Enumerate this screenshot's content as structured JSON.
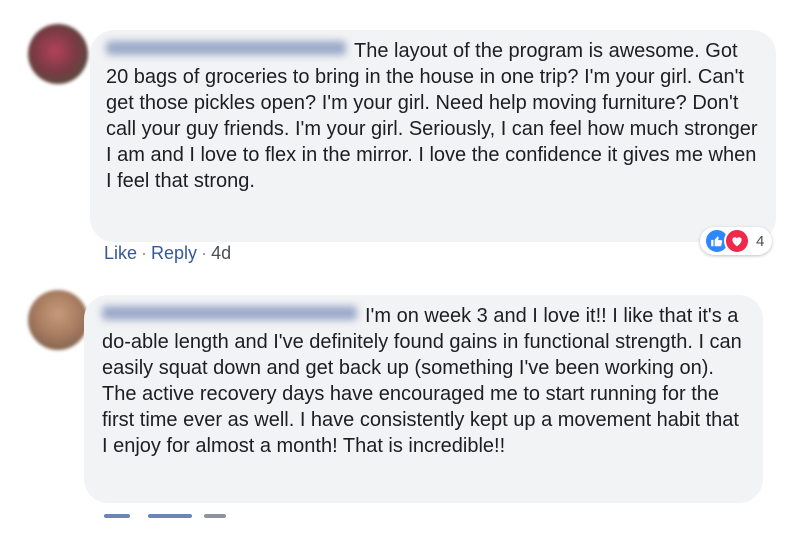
{
  "comments": [
    {
      "text": "The layout of the program is awesome. Got 20 bags of groceries to bring in the house in one trip? I'm your girl. Can't get those pickles open? I'm your girl. Need help moving furniture? Don't call your guy friends. I'm your girl. Seriously, I can feel how much stronger I am and I love to flex in the mirror. I love the confidence it gives me when I feel that strong.",
      "like_label": "Like",
      "reply_label": "Reply",
      "separator": "·",
      "time": "4d",
      "reaction_count": "4",
      "reactions": [
        "like-icon",
        "love-icon"
      ]
    },
    {
      "text": "I'm on week 3 and I love it!! I like that it's a do-able length and I've definitely found gains in functional strength. I can easily squat down and get back up (something I've been working on). The active recovery days have encouraged me to start running for the first time ever as well. I have consistently kept up a movement habit that I enjoy for almost a month! That is incredible!!"
    }
  ],
  "colors": {
    "bubble": "#f2f3f5",
    "link": "#365899",
    "like_reaction": "#2d88ff",
    "love_reaction": "#f0284a"
  }
}
